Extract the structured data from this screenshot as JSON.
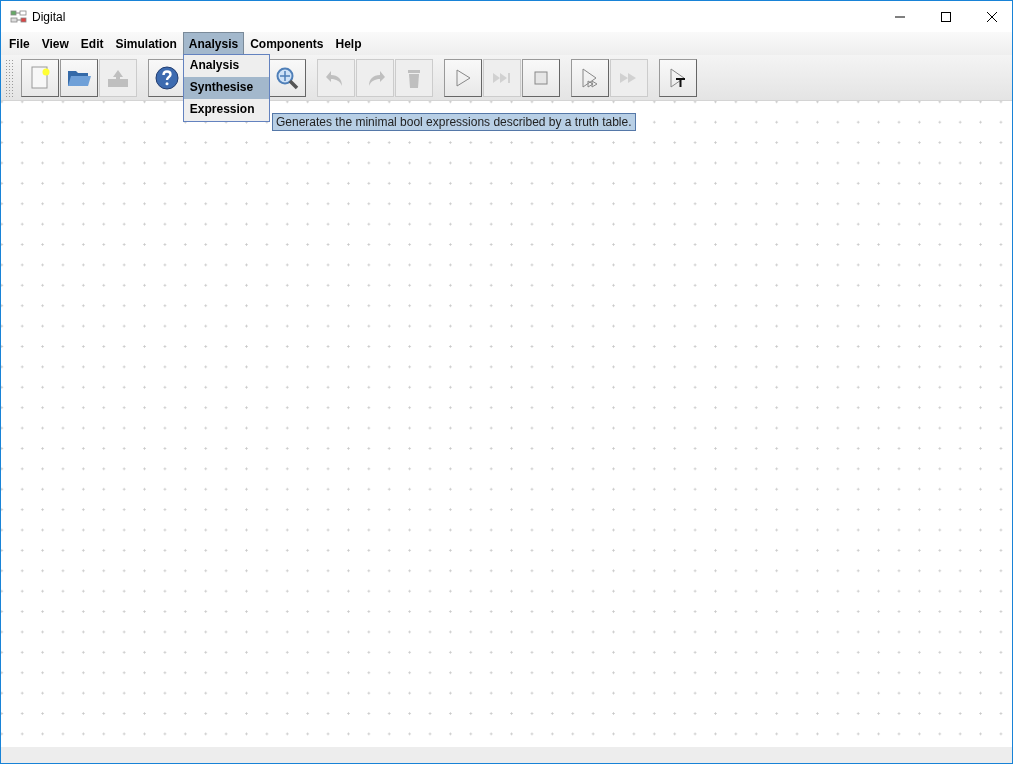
{
  "window": {
    "title": "Digital"
  },
  "menu": [
    {
      "label": "File",
      "selected": false
    },
    {
      "label": "View",
      "selected": false
    },
    {
      "label": "Edit",
      "selected": false
    },
    {
      "label": "Simulation",
      "selected": false
    },
    {
      "label": "Analysis",
      "selected": true
    },
    {
      "label": "Components",
      "selected": false
    },
    {
      "label": "Help",
      "selected": false
    }
  ],
  "dropdown": [
    {
      "label": "Analysis",
      "selected": false
    },
    {
      "label": "Synthesise",
      "selected": true
    },
    {
      "label": "Expression",
      "selected": false
    }
  ],
  "tooltip": "Generates the minimal bool expressions described by a truth table.",
  "toolbar": [
    [
      {
        "kind": "new",
        "disabled": false
      },
      {
        "kind": "open",
        "disabled": false
      },
      {
        "kind": "save",
        "disabled": true
      }
    ],
    [
      {
        "kind": "help",
        "disabled": false
      },
      {
        "kind": "zoom",
        "disabled": false
      }
    ],
    [
      {
        "kind": "undo",
        "disabled": true
      },
      {
        "kind": "redo",
        "disabled": true
      },
      {
        "kind": "delete",
        "disabled": true
      }
    ],
    [
      {
        "kind": "play",
        "disabled": false
      },
      {
        "kind": "step",
        "disabled": true
      },
      {
        "kind": "stop",
        "disabled": false
      }
    ],
    [
      {
        "kind": "runbreak",
        "disabled": false
      },
      {
        "kind": "fast",
        "disabled": true
      }
    ],
    [
      {
        "kind": "test",
        "disabled": false
      }
    ]
  ]
}
